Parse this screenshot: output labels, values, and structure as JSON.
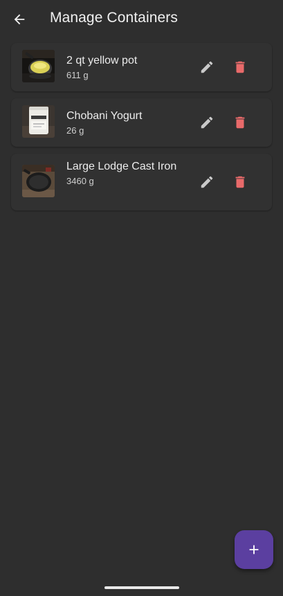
{
  "appbar": {
    "title": "Manage Containers",
    "back_icon": "arrow-back-icon"
  },
  "containers": [
    {
      "name": "2 qt yellow pot",
      "weight": "611 g",
      "thumb_icon": "pot-photo"
    },
    {
      "name": "Chobani Yogurt",
      "weight": "26 g",
      "thumb_icon": "yogurt-photo"
    },
    {
      "name": "Large Lodge Cast Iron",
      "weight": "3460 g",
      "thumb_icon": "cast-iron-photo"
    }
  ],
  "actions": {
    "edit_icon": "pencil-icon",
    "delete_icon": "trash-icon"
  },
  "fab": {
    "icon": "plus-icon"
  },
  "colors": {
    "background": "#2e2e2e",
    "card": "#313131",
    "delete": "#e86a6a",
    "edit": "#c9c9c9",
    "fab": "#5b3fa0"
  }
}
